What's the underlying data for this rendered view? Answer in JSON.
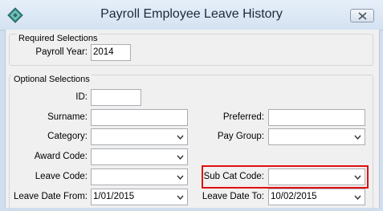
{
  "window": {
    "title": "Payroll Employee Leave History",
    "icons": {
      "app": "diamond-app-icon",
      "close": "close-icon",
      "dropdown": "chevron-down-icon"
    }
  },
  "required": {
    "legend": "Required Selections",
    "payroll_year": {
      "label": "Payroll Year:",
      "value": "2014"
    }
  },
  "optional": {
    "legend": "Optional Selections",
    "id": {
      "label": "ID:",
      "value": ""
    },
    "surname": {
      "label": "Surname:",
      "value": ""
    },
    "preferred": {
      "label": "Preferred:",
      "value": ""
    },
    "category": {
      "label": "Category:",
      "value": ""
    },
    "pay_group": {
      "label": "Pay Group:",
      "value": ""
    },
    "award_code": {
      "label": "Award Code:",
      "value": ""
    },
    "leave_code": {
      "label": "Leave Code:",
      "value": ""
    },
    "sub_cat_code": {
      "label": "Sub Cat Code:",
      "value": ""
    },
    "leave_date_from": {
      "label": "Leave Date From:",
      "value": "1/01/2015"
    },
    "leave_date_to": {
      "label": "Leave Date To:",
      "value": "10/02/2015"
    }
  },
  "colors": {
    "highlight": "#e01010",
    "client_bg": "#f0f0f0",
    "frame": "#cfdff0"
  }
}
